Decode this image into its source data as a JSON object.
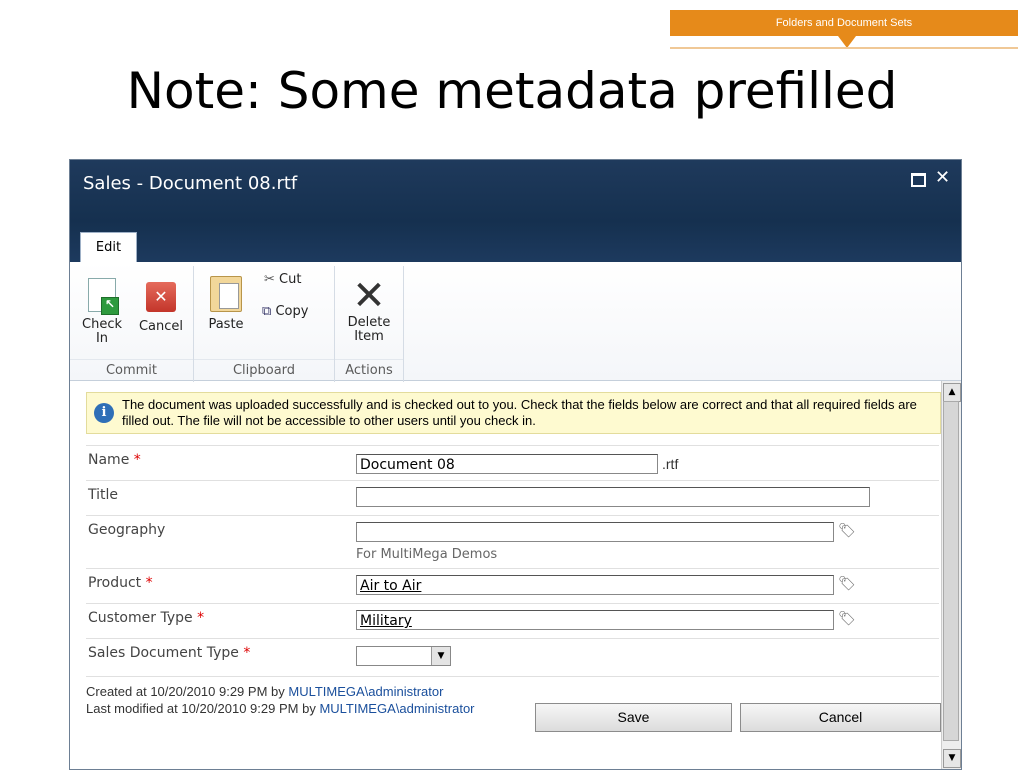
{
  "banner": {
    "label": "Folders and Document Sets"
  },
  "slide_title": "Note: Some metadata prefilled",
  "dialog": {
    "title": "Sales - Document 08.rtf",
    "tab": "Edit"
  },
  "ribbon": {
    "groups": [
      {
        "label": "Commit",
        "buttons": [
          "Check",
          "In",
          "Cancel"
        ]
      },
      {
        "label": "Clipboard",
        "paste": "Paste",
        "cut": "Cut",
        "copy": "Copy"
      },
      {
        "label": "Actions",
        "delete_1": "Delete",
        "delete_2": "Item"
      }
    ]
  },
  "notice": {
    "text": "The document was uploaded successfully and is checked out to you. Check that the fields below are correct and that all required fields are filled out. The file will not be accessible to other users until you check in."
  },
  "form": {
    "name": {
      "label": "Name",
      "required": "*",
      "value": "Document 08",
      "ext": ".rtf"
    },
    "title": {
      "label": "Title",
      "value": ""
    },
    "geography": {
      "label": "Geography",
      "value": "",
      "hint": "For MultiMega Demos"
    },
    "product": {
      "label": "Product",
      "required": "*",
      "value": "Air to Air"
    },
    "customer_type": {
      "label": "Customer Type",
      "required": "*",
      "value": "Military"
    },
    "sales_doc_type": {
      "label": "Sales Document Type",
      "required": "*",
      "value": ""
    }
  },
  "footer": {
    "created_prefix": "Created at 10/20/2010 9:29 PM  by ",
    "created_user": "MULTIMEGA\\administrator",
    "modified_prefix": "Last modified at 10/20/2010 9:29 PM  by ",
    "modified_user": "MULTIMEGA\\administrator"
  },
  "buttons": {
    "save": "Save",
    "cancel": "Cancel"
  },
  "colors": {
    "titlebar": "#1f3a5c",
    "banner": "#e68a1a",
    "notice_bg": "#fefad0",
    "required": "#dd0000"
  },
  "icons": [
    "check-in-icon",
    "cancel-icon",
    "paste-icon",
    "cut-icon",
    "copy-icon",
    "delete-icon",
    "info-icon",
    "tag-icon",
    "maximize-icon",
    "close-icon"
  ]
}
